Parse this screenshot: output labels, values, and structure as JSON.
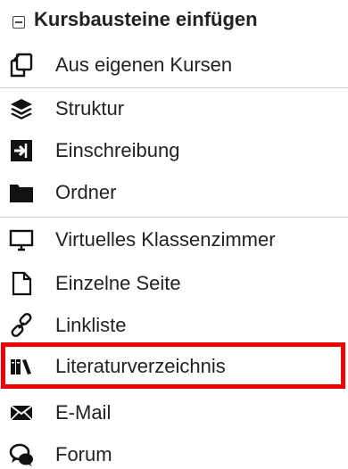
{
  "header": {
    "title": "Kursbausteine einfügen"
  },
  "items": [
    {
      "label": "Aus eigenen Kursen",
      "icon": "copy-icon"
    },
    {
      "label": "Struktur",
      "icon": "layers-icon"
    },
    {
      "label": "Einschreibung",
      "icon": "sign-in-icon"
    },
    {
      "label": "Ordner",
      "icon": "folder-icon"
    },
    {
      "label": "Virtuelles Klassenzimmer",
      "icon": "monitor-icon"
    },
    {
      "label": "Einzelne Seite",
      "icon": "file-icon"
    },
    {
      "label": "Linkliste",
      "icon": "link-icon"
    },
    {
      "label": "Literaturverzeichnis",
      "icon": "books-icon"
    },
    {
      "label": "E-Mail",
      "icon": "envelope-icon"
    },
    {
      "label": "Forum",
      "icon": "chat-icon"
    }
  ],
  "colors": {
    "highlight": "#ee0000",
    "divider": "#cfcfcf",
    "text": "#222222"
  }
}
